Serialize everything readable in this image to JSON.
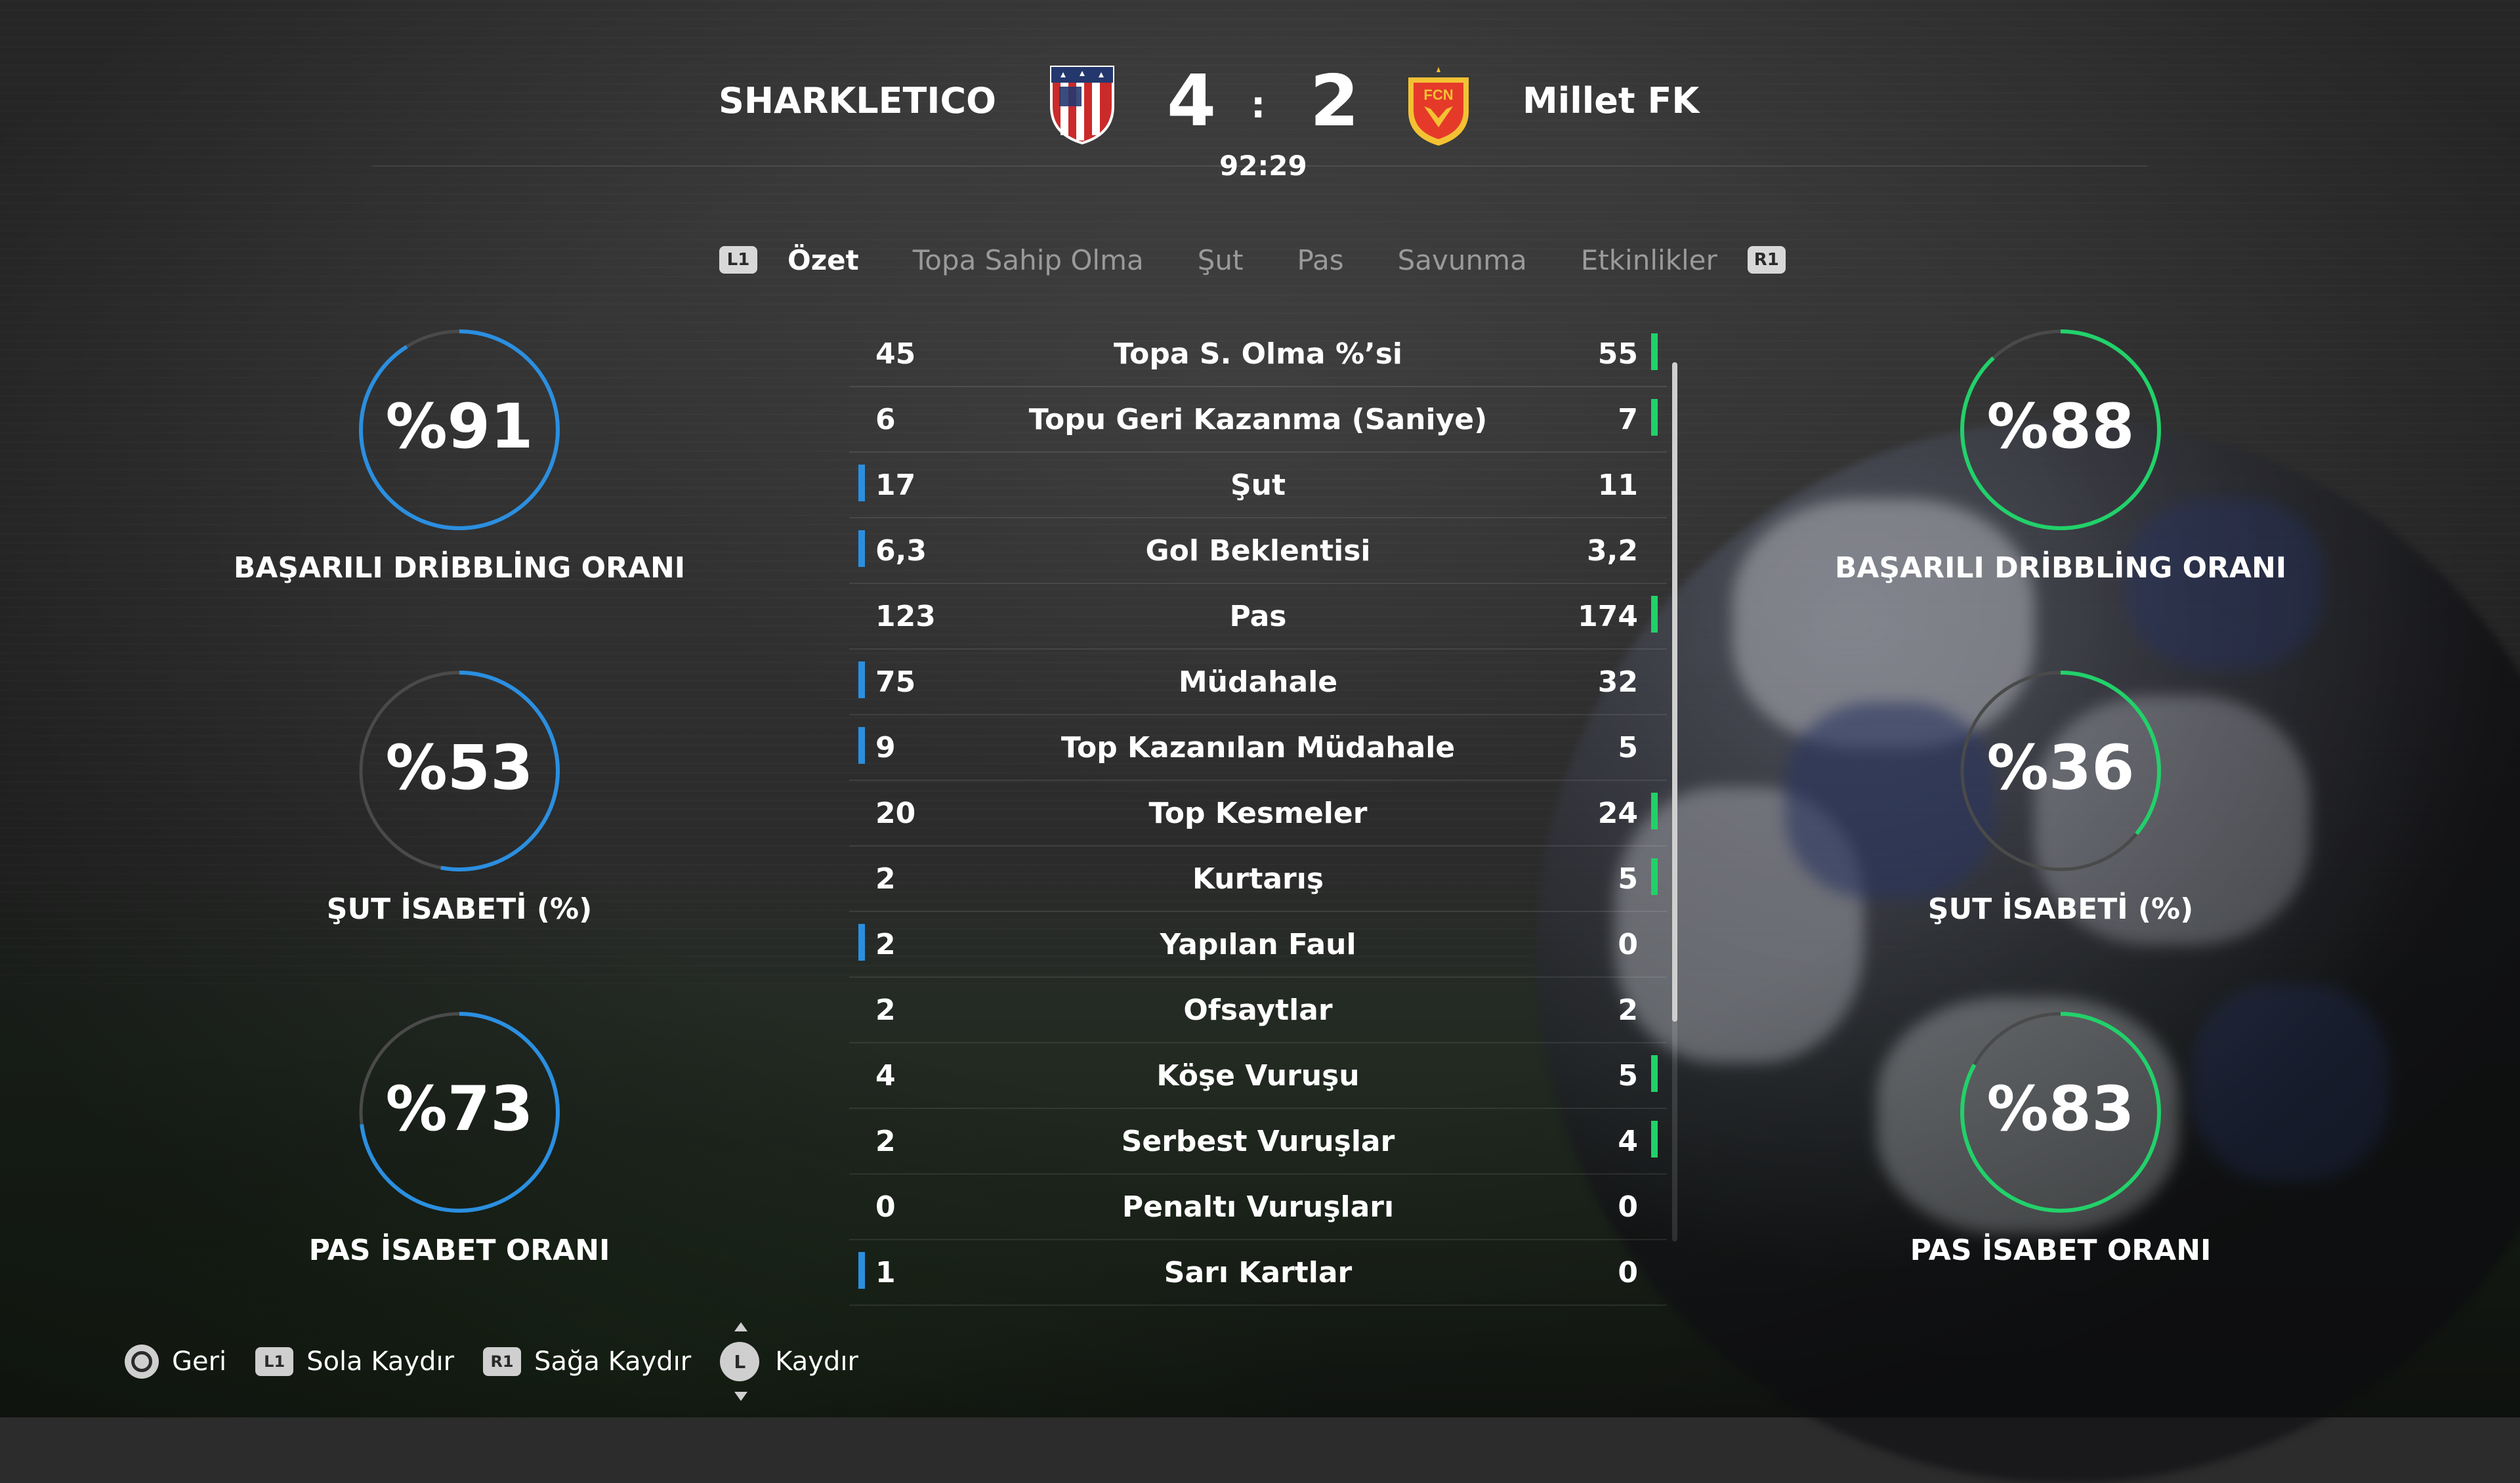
{
  "header": {
    "home_team": "SHARKLETICO",
    "away_team": "Millet FK",
    "home_score": "4",
    "away_score": "2",
    "separator": ":",
    "clock": "92:29",
    "home_crest_text": "",
    "away_crest_text": "FCN"
  },
  "tabs": {
    "left_button": "L1",
    "right_button": "R1",
    "items": [
      "Özet",
      "Topa Sahip Olma",
      "Şut",
      "Pas",
      "Savunma",
      "Etkinlikler"
    ],
    "active_index": 0
  },
  "stats": [
    {
      "label": "Topa S. Olma %’si",
      "home": "45",
      "away": "55",
      "leader": "away"
    },
    {
      "label": "Topu Geri Kazanma (Saniye)",
      "home": "6",
      "away": "7",
      "leader": "away"
    },
    {
      "label": "Şut",
      "home": "17",
      "away": "11",
      "leader": "home"
    },
    {
      "label": "Gol Beklentisi",
      "home": "6,3",
      "away": "3,2",
      "leader": "home"
    },
    {
      "label": "Pas",
      "home": "123",
      "away": "174",
      "leader": "away"
    },
    {
      "label": "Müdahale",
      "home": "75",
      "away": "32",
      "leader": "home"
    },
    {
      "label": "Top Kazanılan Müdahale",
      "home": "9",
      "away": "5",
      "leader": "home"
    },
    {
      "label": "Top Kesmeler",
      "home": "20",
      "away": "24",
      "leader": "away"
    },
    {
      "label": "Kurtarış",
      "home": "2",
      "away": "5",
      "leader": "away"
    },
    {
      "label": "Yapılan Faul",
      "home": "2",
      "away": "0",
      "leader": "home"
    },
    {
      "label": "Ofsaytlar",
      "home": "2",
      "away": "2",
      "leader": "none"
    },
    {
      "label": "Köşe Vuruşu",
      "home": "4",
      "away": "5",
      "leader": "away"
    },
    {
      "label": "Serbest Vuruşlar",
      "home": "2",
      "away": "4",
      "leader": "away"
    },
    {
      "label": "Penaltı Vuruşları",
      "home": "0",
      "away": "0",
      "leader": "none"
    },
    {
      "label": "Sarı Kartlar",
      "home": "1",
      "away": "0",
      "leader": "home"
    }
  ],
  "home_rings": [
    {
      "value": "%91",
      "pct": 91,
      "label": "BAŞARILI DRİBBLİNG ORANI"
    },
    {
      "value": "%53",
      "pct": 53,
      "label": "ŞUT İSABETİ (%)"
    },
    {
      "value": "%73",
      "pct": 73,
      "label": "PAS İSABET ORANI"
    }
  ],
  "away_rings": [
    {
      "value": "%88",
      "pct": 88,
      "label": "BAŞARILI DRİBBLİNG ORANI"
    },
    {
      "value": "%36",
      "pct": 36,
      "label": "ŞUT İSABETİ (%)"
    },
    {
      "value": "%83",
      "pct": 83,
      "label": "PAS İSABET ORANI"
    }
  ],
  "colors": {
    "home_accent": "#2b8fe0",
    "away_accent": "#22d16a",
    "ring_track": "#4a4a4a"
  },
  "scroll": {
    "visible_fraction": 0.75
  },
  "footer": {
    "back_label": "Geri",
    "l1_button": "L1",
    "l1_label": "Sola Kaydır",
    "r1_button": "R1",
    "r1_label": "Sağa Kaydır",
    "stick_button": "L",
    "stick_label": "Kaydır"
  }
}
